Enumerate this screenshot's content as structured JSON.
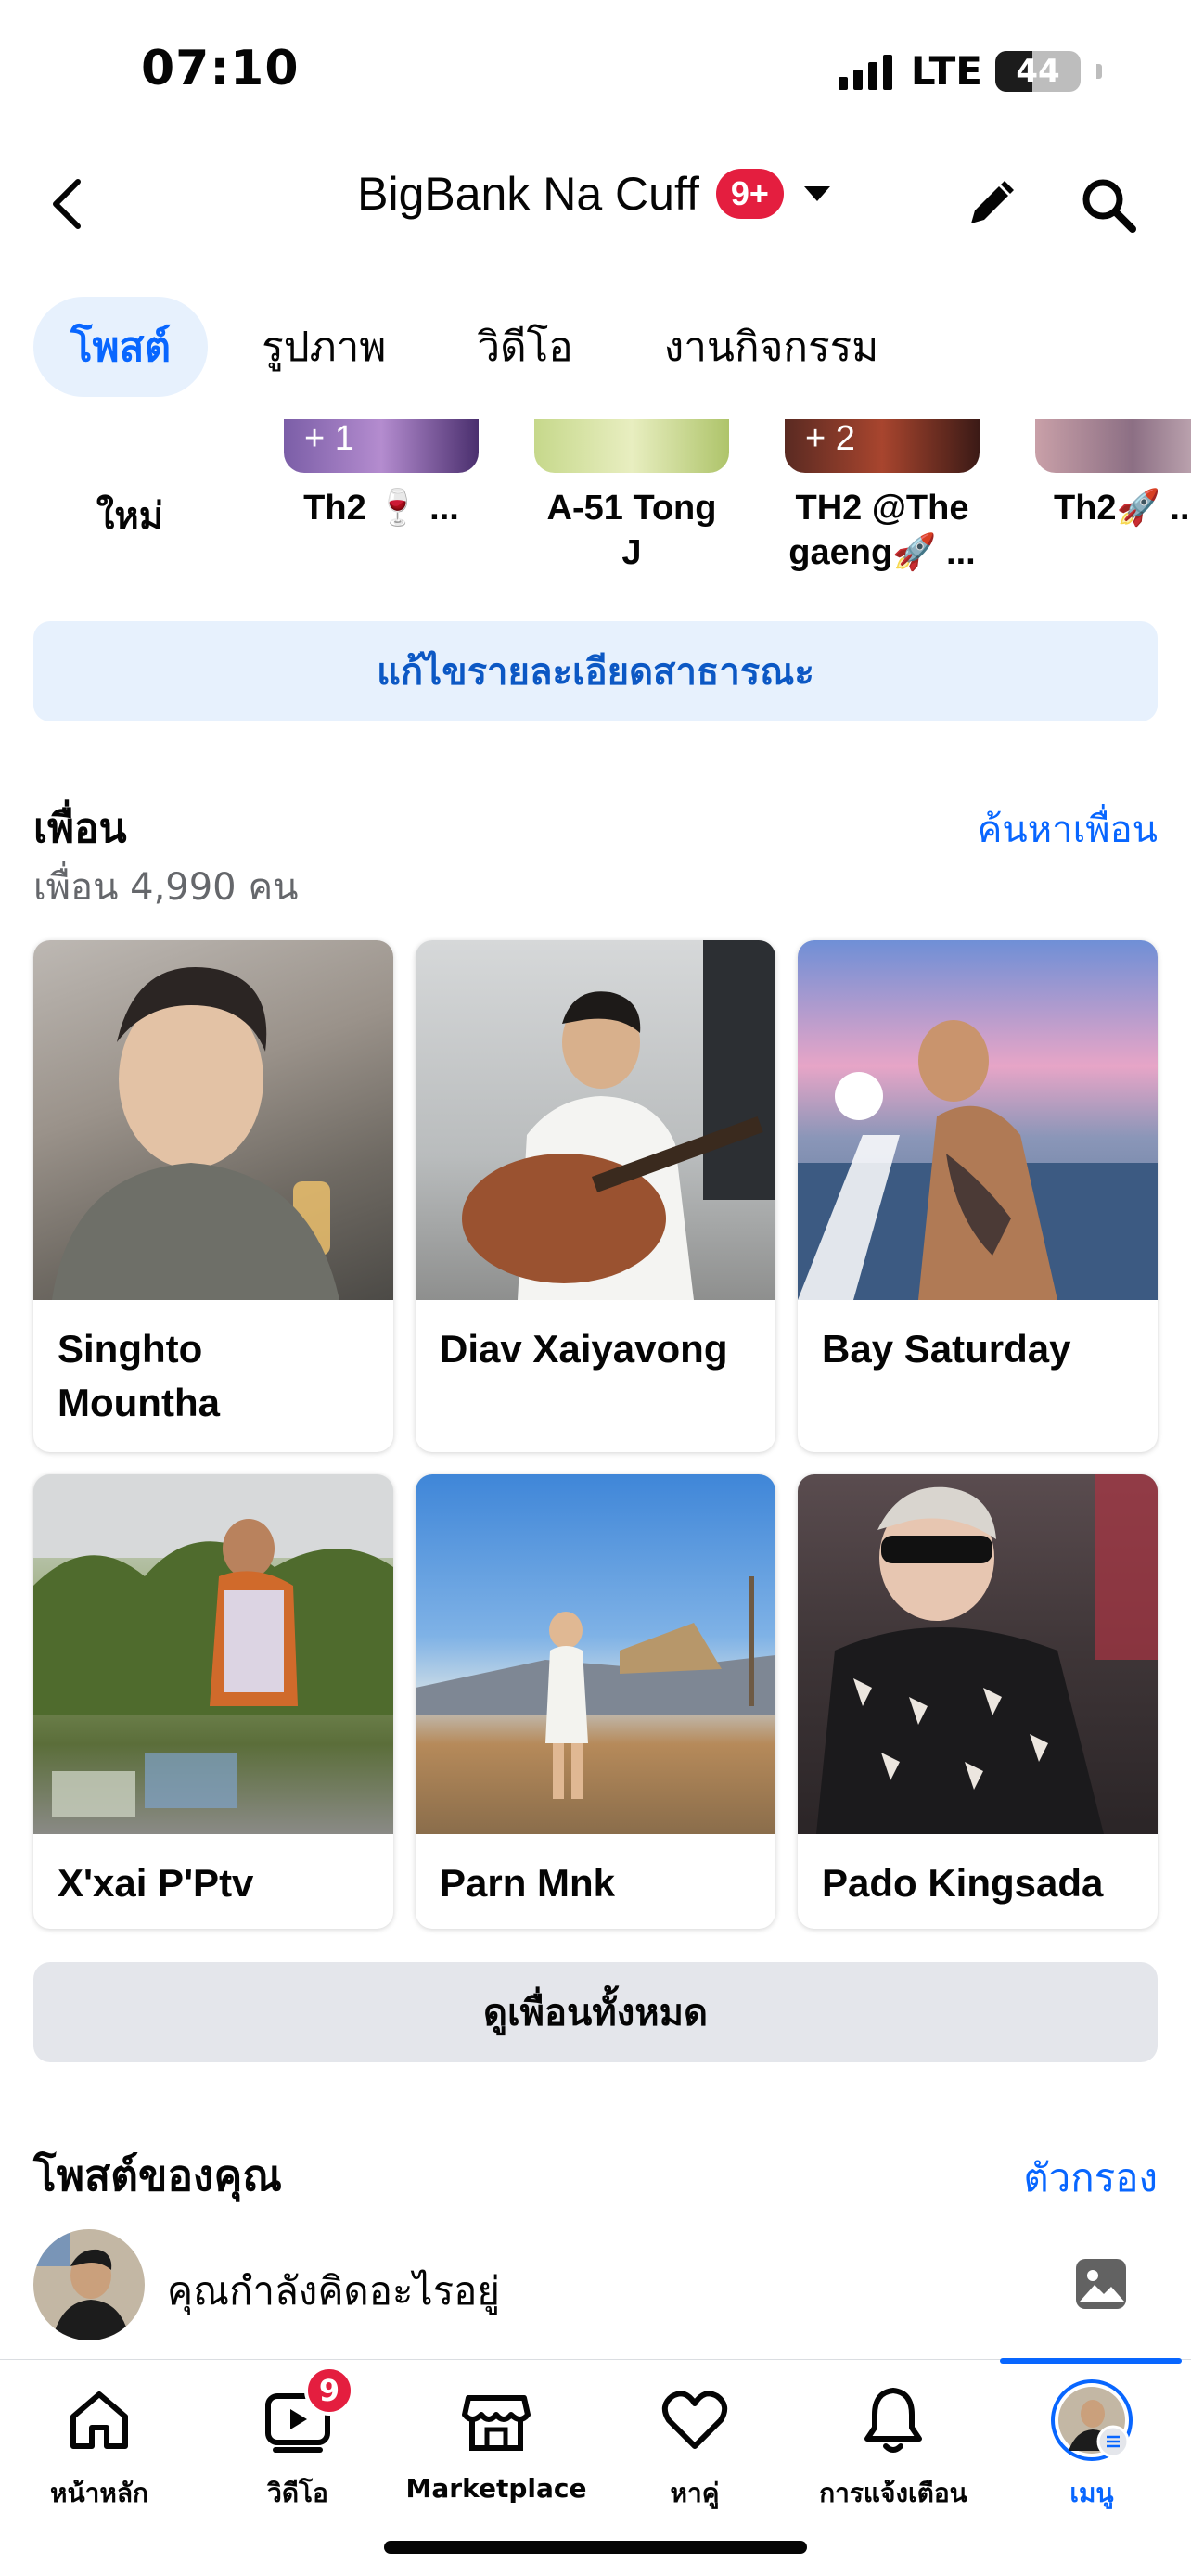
{
  "status_bar": {
    "time": "07:10",
    "network": "LTE",
    "battery": "44"
  },
  "header": {
    "title": "BigBank Na Cuff",
    "badge": "9+"
  },
  "tabs": [
    {
      "label": "โพสต์",
      "active": true
    },
    {
      "label": "รูปภาพ",
      "active": false
    },
    {
      "label": "วิดีโอ",
      "active": false
    },
    {
      "label": "งานกิจกรรม",
      "active": false
    }
  ],
  "highlights": {
    "new_label": "ใหม่",
    "items": [
      {
        "label": "Th2 🍷 ...",
        "count": "+ 1"
      },
      {
        "label": "A-51 Tong J",
        "count": ""
      },
      {
        "label": "TH2 @The gaeng🚀 ...",
        "count": "+ 2"
      },
      {
        "label": "Th2🚀 ...",
        "count": ""
      }
    ]
  },
  "edit_details_label": "แก้ไขรายละเอียดสาธารณะ",
  "friends": {
    "title": "เพื่อน",
    "count_text": "เพื่อน 4,990 คน",
    "find_label": "ค้นหาเพื่อน",
    "items": [
      {
        "name": "Singhto Mountha"
      },
      {
        "name": "Diav Xaiyavong"
      },
      {
        "name": "Bay Saturday"
      },
      {
        "name": "X'xai P'Ptv"
      },
      {
        "name": "Parn Mnk"
      },
      {
        "name": "Pado Kingsada"
      }
    ],
    "see_all_label": "ดูเพื่อนทั้งหมด"
  },
  "posts": {
    "title": "โพสต์ของคุณ",
    "filter_label": "ตัวกรอง",
    "composer_placeholder": "คุณกำลังคิดอะไรอยู่"
  },
  "bottom_nav": {
    "items": [
      {
        "label": "หน้าหลัก",
        "icon": "home-icon"
      },
      {
        "label": "วิดีโอ",
        "icon": "video-icon",
        "badge": "9"
      },
      {
        "label": "Marketplace",
        "icon": "marketplace-icon"
      },
      {
        "label": "หาคู่",
        "icon": "dating-icon"
      },
      {
        "label": "การแจ้งเตือน",
        "icon": "bell-icon"
      },
      {
        "label": "เมนู",
        "icon": "menu-avatar-icon",
        "active": true
      }
    ]
  },
  "colors": {
    "accent": "#0866ff",
    "badge": "#e41e3f",
    "tab_active_bg": "#e7f1fd"
  }
}
